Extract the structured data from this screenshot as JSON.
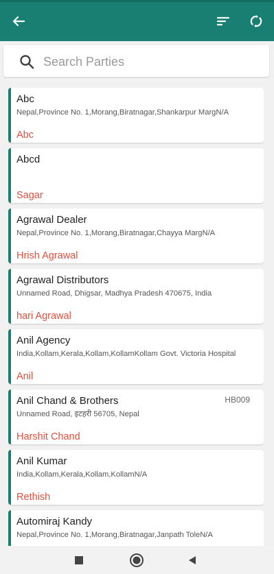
{
  "colors": {
    "primary": "#1a7f73",
    "contact": "#e0503f"
  },
  "appbar": {
    "back_icon": "arrow-left-icon",
    "sort_icon": "sort-icon",
    "sync_icon": "sync-icon"
  },
  "search": {
    "placeholder": "Search Parties",
    "value": "",
    "icon": "search-icon"
  },
  "parties": [
    {
      "name": "Abc",
      "code": "",
      "address": "Nepal,Province No. 1,Morang,Biratnagar,Shankarpur MargN/A",
      "contact": "Abc"
    },
    {
      "name": "Abcd",
      "code": "",
      "address": "",
      "contact": "Sagar"
    },
    {
      "name": "Agrawal Dealer",
      "code": "",
      "address": "Nepal,Province No. 1,Morang,Biratnagar,Chayya MargN/A",
      "contact": "Hrish Agrawal"
    },
    {
      "name": "Agrawal Distributors",
      "code": "",
      "address": "Unnamed Road, Dhigsar, Madhya Pradesh 470675, India",
      "contact": "hari Agrawal"
    },
    {
      "name": "Anil Agency",
      "code": "",
      "address": "India,Kollam,Kerala,Kollam,KollamKollam Govt. Victoria Hospital",
      "contact": "Anil"
    },
    {
      "name": "Anil Chand & Brothers",
      "code": "HB009",
      "address": "Unnamed Road, इटहरी 56705, Nepal",
      "contact": "Harshit Chand"
    },
    {
      "name": "Anil Kumar",
      "code": "",
      "address": "India,Kollam,Kerala,Kollam,KollamN/A",
      "contact": "Rethish"
    },
    {
      "name": "Automiraj Kandy",
      "code": "",
      "address": "Nepal,Province No. 1,Morang,Biratnagar,Janpath ToleN/A",
      "contact": ""
    }
  ],
  "navbar": {
    "recents_icon": "square-icon",
    "home_icon": "circle-icon",
    "back_icon": "triangle-back-icon"
  }
}
